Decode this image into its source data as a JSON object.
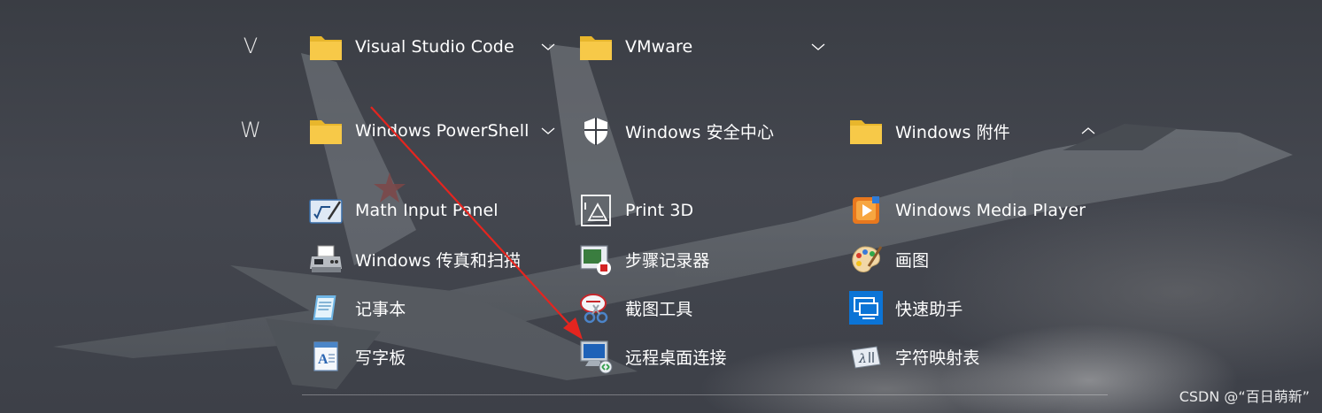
{
  "groups": [
    {
      "letter": "V"
    },
    {
      "letter": "W"
    }
  ],
  "folders": {
    "vscode": {
      "label": "Visual Studio Code"
    },
    "vmware": {
      "label": "VMware"
    },
    "powershell": {
      "label": "Windows PowerShell"
    },
    "security": {
      "label": "Windows 安全中心"
    },
    "accessories": {
      "label": "Windows 附件"
    }
  },
  "apps": [
    {
      "label": "Math Input Panel",
      "icon": "math-input-panel-icon"
    },
    {
      "label": "Print 3D",
      "icon": "print-3d-icon"
    },
    {
      "label": "Windows Media Player",
      "icon": "windows-media-player-icon"
    },
    {
      "label": "Windows 传真和扫描",
      "icon": "fax-scanner-icon"
    },
    {
      "label": "步骤记录器",
      "icon": "steps-recorder-icon"
    },
    {
      "label": "画图",
      "icon": "paint-palette-icon"
    },
    {
      "label": "记事本",
      "icon": "notepad-icon"
    },
    {
      "label": "截图工具",
      "icon": "snipping-tool-icon"
    },
    {
      "label": "快速助手",
      "icon": "quick-assist-icon"
    },
    {
      "label": "写字板",
      "icon": "wordpad-icon"
    },
    {
      "label": "远程桌面连接",
      "icon": "remote-desktop-icon"
    },
    {
      "label": "字符映射表",
      "icon": "character-map-icon"
    }
  ],
  "watermark": "CSDN @“百日萌新”",
  "colors": {
    "folder": "#f7c948",
    "arrow": "#e5251f",
    "text": "#ffffff"
  }
}
